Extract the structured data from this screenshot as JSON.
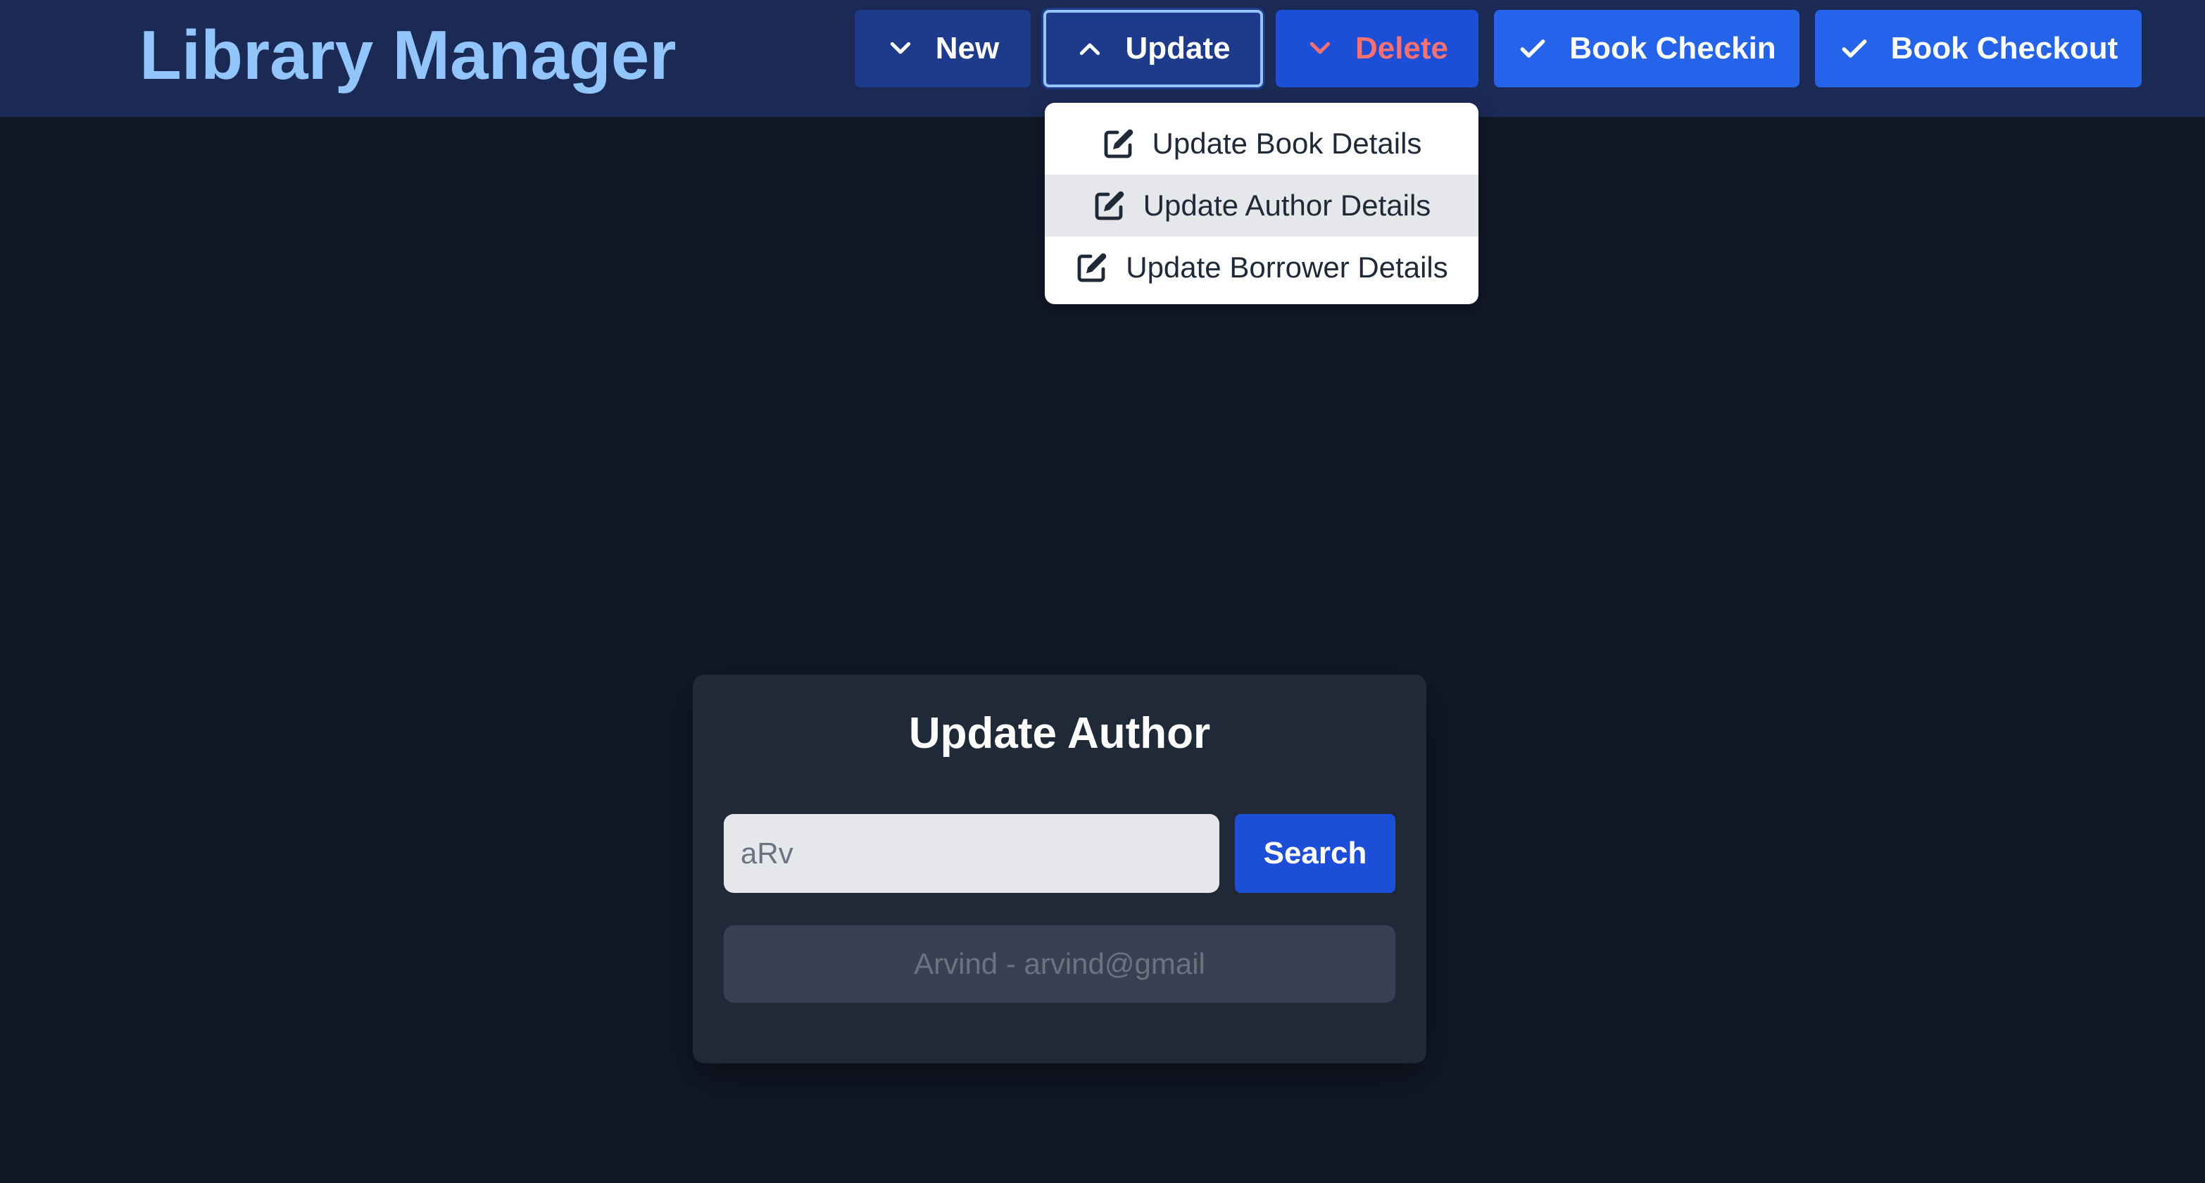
{
  "header": {
    "title": "Library Manager",
    "buttons": {
      "new": "New",
      "update": "Update",
      "delete": "Delete",
      "checkin": "Book Checkin",
      "checkout": "Book Checkout"
    },
    "icons": {
      "new": "chevron-down-icon",
      "update": "chevron-up-icon",
      "delete": "chevron-down-icon",
      "checkin": "check-icon",
      "checkout": "check-icon"
    }
  },
  "update_menu": {
    "items": [
      {
        "label": "Update Book Details",
        "icon": "edit-icon"
      },
      {
        "label": "Update Author Details",
        "icon": "edit-icon",
        "highlighted": true
      },
      {
        "label": "Update Borrower Details",
        "icon": "edit-icon"
      }
    ]
  },
  "card": {
    "title": "Update Author",
    "search_value": "aRv",
    "search_button": "Search",
    "results": [
      "Arvind - arvind@gmail"
    ]
  },
  "colors": {
    "background": "#111827",
    "header": "#1b2a55",
    "title": "#93c5fd",
    "primary": "#2563eb",
    "delete_text": "#f87171",
    "card": "#1f2937"
  }
}
